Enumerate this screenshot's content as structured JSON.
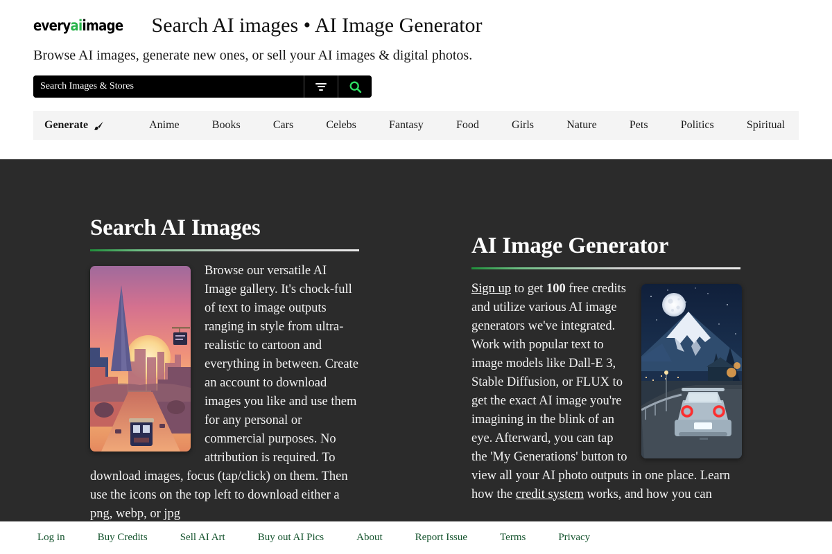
{
  "header": {
    "logo": {
      "part1": "every",
      "part2": "ai",
      "part3": "image"
    },
    "title": "Search AI images • AI Image Generator",
    "tagline": "Browse AI images, generate new ones, or sell your AI images & digital photos."
  },
  "search": {
    "placeholder": "Search Images & Stores",
    "value": "",
    "filter_icon": "filter-icon",
    "search_icon": "search-icon"
  },
  "nav": {
    "generate": {
      "label": "Generate",
      "icon": "paintbrush-icon"
    },
    "items": [
      {
        "label": "Anime"
      },
      {
        "label": "Books"
      },
      {
        "label": "Cars"
      },
      {
        "label": "Celebs"
      },
      {
        "label": "Fantasy"
      },
      {
        "label": "Food"
      },
      {
        "label": "Girls"
      },
      {
        "label": "Nature"
      },
      {
        "label": "Pets"
      },
      {
        "label": "Politics"
      },
      {
        "label": "Spiritual"
      }
    ]
  },
  "main": {
    "left": {
      "heading": "Search AI Images",
      "para_1": "Browse our versatile AI Image gallery. It's chock-full of text to image outputs ranging in style from ultra-realistic to cartoon and everything in between. Create an account to download images you like and use them for any personal or commercial purposes. No attribution is required. To download images, focus (tap/click) on them. Then use the icons on the top left to download either a png, webp, or jpg",
      "thumb_alt": "san-francisco-sunset-ai-image"
    },
    "right": {
      "heading": "AI Image Generator",
      "signup_link": "Sign up",
      "para_lead_1": " to get ",
      "credits_count": "100",
      "para_lead_2": " free credits and utilize various AI image generators we've integrated. Work with popular text to image models like Dall-E 3, Stable Diffusion, or FLUX to get the exact AI image you're imagining in the blink of an eye. Afterward, you can tap the 'My Generations' button to view all your AI photo outputs in one place. Learn how the ",
      "credit_link": "credit system",
      "para_tail": " works, and how you can",
      "thumb_alt": "mount-fuji-night-car-ai-image"
    }
  },
  "footer": {
    "links": [
      {
        "label": "Log in"
      },
      {
        "label": "Buy Credits"
      },
      {
        "label": "Sell AI Art"
      },
      {
        "label": "Buy out AI Pics"
      },
      {
        "label": "About"
      },
      {
        "label": "Report Issue"
      },
      {
        "label": "Terms"
      },
      {
        "label": "Privacy"
      }
    ]
  },
  "colors": {
    "brand_green": "#27b34a",
    "accent_green": "#1f8f3a",
    "footer_link": "#14532d",
    "dark_bg": "#2b2b2b",
    "nav_bg": "#f4f4f4",
    "search_bg": "#000000"
  }
}
